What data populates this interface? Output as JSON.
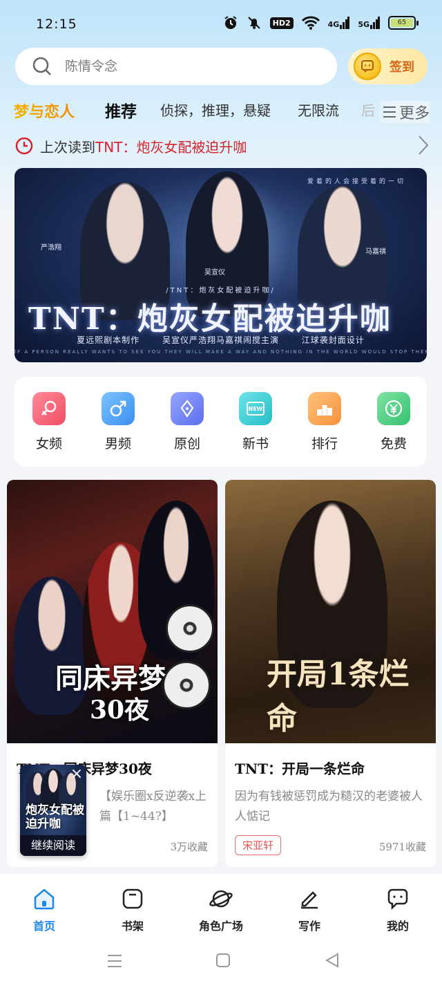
{
  "status_bar": {
    "time": "12:15",
    "hd_label": "HD2",
    "net1": "4G",
    "net2": "5G",
    "battery": "65"
  },
  "search": {
    "placeholder": "陈情令念",
    "checkin_label": "签到"
  },
  "categories": {
    "brand": "梦与恋人",
    "items": [
      "推荐",
      "侦探，推理，悬疑",
      "无限流",
      "后"
    ],
    "more_label": "更多"
  },
  "last_read": {
    "prefix": "上次读到",
    "book": "TNT：炮灰女配被迫升咖"
  },
  "banner": {
    "title": "TNT：炮灰女配被迫升咖",
    "subtitle": "/TNT：炮灰女配被迫升咖/",
    "credits": "夏远熙剧本制作 吴宣仪严浩翔马嘉祺闹搅主演 江球袭封面设计",
    "top_text": "爱着的人会接受着的一切",
    "fine_print": "IF A PERSON REALLY WANTS TO SEE YOU THEY WILL MAKE A WAY AND NOTHING IN THE WORLD WOULD STOP THEM.",
    "name_left": "严浩翔",
    "name_mid": "吴宣仪",
    "name_right": "马嘉祺"
  },
  "quick_links": [
    {
      "label": "女频",
      "icon": "female-icon",
      "color": "#f56a7b"
    },
    {
      "label": "男频",
      "icon": "male-icon",
      "color": "#4ea6f5"
    },
    {
      "label": "原创",
      "icon": "pen-nib-icon",
      "color": "#6f7ef3"
    },
    {
      "label": "新书",
      "icon": "new-book-icon",
      "color": "#41cfd6"
    },
    {
      "label": "排行",
      "icon": "podium-icon",
      "color": "#f7a451"
    },
    {
      "label": "免费",
      "icon": "yen-icon",
      "color": "#4fcf84"
    }
  ],
  "books": [
    {
      "cover_title": "同床异梦",
      "cover_sub": "30夜",
      "title": "TNT：同床异梦30夜",
      "desc": "【娱乐圈x反逆袭x上篇【1~44?】",
      "author": "",
      "favs": "3万收藏"
    },
    {
      "cover_title": "开局1条烂命",
      "title": "TNT：开局一条烂命",
      "desc": "因为有钱被惩罚成为糙汉的老婆被人人惦记",
      "author": "宋亚轩",
      "favs": "5971收藏"
    }
  ],
  "floating": {
    "title": "炮灰女配被迫升咖",
    "cta": "继续阅读"
  },
  "tabbar": [
    {
      "label": "首页",
      "icon": "home-icon",
      "active": true
    },
    {
      "label": "书架",
      "icon": "bookshelf-icon"
    },
    {
      "label": "角色广场",
      "icon": "planet-icon"
    },
    {
      "label": "写作",
      "icon": "pencil-icon"
    },
    {
      "label": "我的",
      "icon": "chat-bubble-icon"
    }
  ],
  "colors": {
    "accent": "#1c86e9",
    "brand_gold": "#f4a300",
    "red": "#d8232a"
  }
}
